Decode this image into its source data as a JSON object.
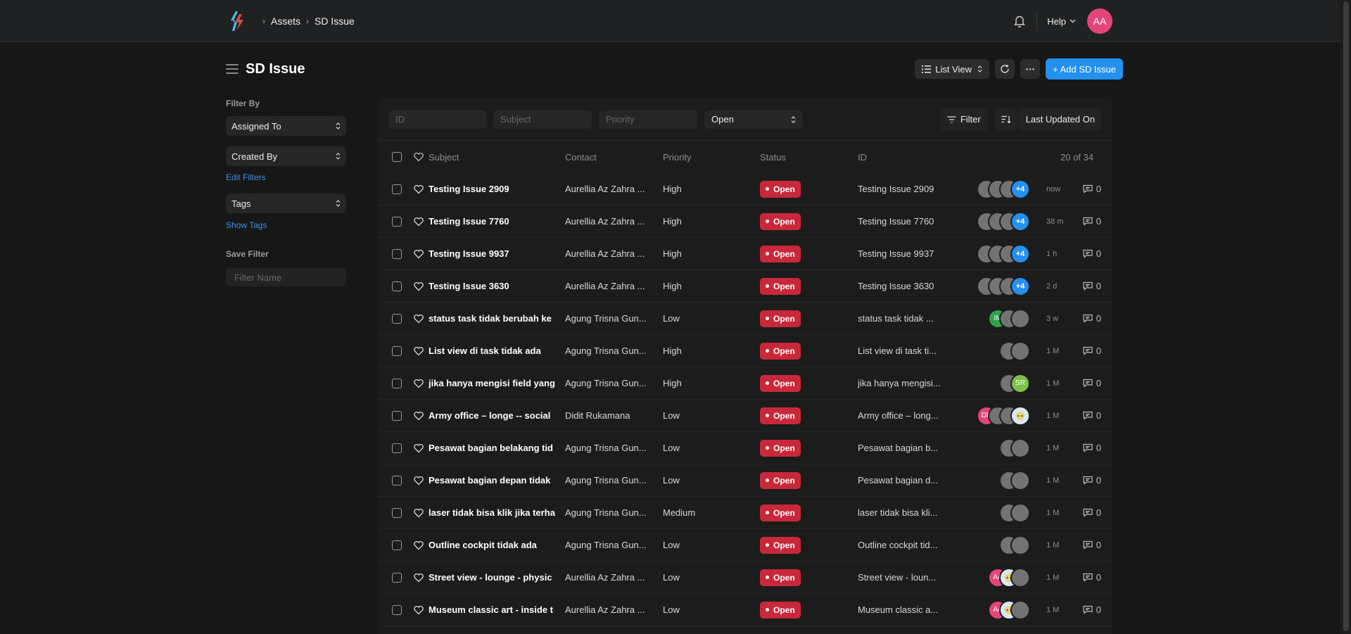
{
  "navbar": {
    "breadcrumbs": [
      "Assets",
      "SD Issue"
    ],
    "help_label": "Help",
    "user_initials": "AA"
  },
  "page": {
    "title": "SD Issue",
    "view_label": "List View",
    "add_button_label": "+ Add SD Issue"
  },
  "sidebar": {
    "filter_by_label": "Filter By",
    "assigned_to": "Assigned To",
    "created_by": "Created By",
    "edit_filters": "Edit Filters",
    "tags": "Tags",
    "show_tags": "Show Tags",
    "save_filter_label": "Save Filter",
    "filter_name_placeholder": "Filter Name"
  },
  "filters": {
    "id_placeholder": "ID",
    "subject_placeholder": "Subject",
    "priority_placeholder": "Priority",
    "status_value": "Open",
    "filter_label": "Filter",
    "sort_label": "Last Updated On"
  },
  "columns": {
    "subject": "Subject",
    "contact": "Contact",
    "priority": "Priority",
    "status": "Status",
    "id": "ID",
    "count": "20 of 34"
  },
  "rows": [
    {
      "subject": "Testing Issue 2909",
      "contact": "Aurellia Az Zahra ...",
      "priority": "High",
      "status": "Open",
      "id": "Testing Issue 2909",
      "time": "now",
      "comments": "0",
      "avatars": [
        {
          "t": ""
        },
        {
          "t": ""
        },
        {
          "t": ""
        },
        {
          "t": "+4",
          "c": "blue"
        }
      ]
    },
    {
      "subject": "Testing Issue 7760",
      "contact": "Aurellia Az Zahra ...",
      "priority": "High",
      "status": "Open",
      "id": "Testing Issue 7760",
      "time": "38 m",
      "comments": "0",
      "avatars": [
        {
          "t": ""
        },
        {
          "t": ""
        },
        {
          "t": ""
        },
        {
          "t": "+4",
          "c": "blue"
        }
      ]
    },
    {
      "subject": "Testing Issue 9937",
      "contact": "Aurellia Az Zahra ...",
      "priority": "High",
      "status": "Open",
      "id": "Testing Issue 9937",
      "time": "1 h",
      "comments": "0",
      "avatars": [
        {
          "t": ""
        },
        {
          "t": ""
        },
        {
          "t": ""
        },
        {
          "t": "+4",
          "c": "blue"
        }
      ]
    },
    {
      "subject": "Testing Issue 3630",
      "contact": "Aurellia Az Zahra ...",
      "priority": "High",
      "status": "Open",
      "id": "Testing Issue 3630",
      "time": "2 d",
      "comments": "0",
      "avatars": [
        {
          "t": ""
        },
        {
          "t": ""
        },
        {
          "t": ""
        },
        {
          "t": "+4",
          "c": "blue"
        }
      ]
    },
    {
      "subject": "status task tidak berubah ke",
      "contact": "Agung Trisna Gun...",
      "priority": "Low",
      "status": "Open",
      "id": "status task tidak ...",
      "time": "3 w",
      "comments": "0",
      "avatars": [
        {
          "t": "IM",
          "c": "green"
        },
        {
          "t": ""
        },
        {
          "t": ""
        }
      ]
    },
    {
      "subject": "List view di task tidak ada",
      "contact": "Agung Trisna Gun...",
      "priority": "High",
      "status": "Open",
      "id": "List view di task ti...",
      "time": "1 M",
      "comments": "0",
      "avatars": [
        {
          "t": ""
        },
        {
          "t": ""
        }
      ]
    },
    {
      "subject": "jika hanya mengisi field yang",
      "contact": "Agung Trisna Gun...",
      "priority": "High",
      "status": "Open",
      "id": "jika hanya mengisi...",
      "time": "1 M",
      "comments": "0",
      "avatars": [
        {
          "t": ""
        },
        {
          "t": "SR",
          "c": "lime"
        }
      ]
    },
    {
      "subject": "Army office – longe -- social",
      "contact": "Didit Rukamana",
      "priority": "Low",
      "status": "Open",
      "id": "Army office – long...",
      "time": "1 M",
      "comments": "0",
      "avatars": [
        {
          "t": "DR",
          "c": "pink"
        },
        {
          "t": ""
        },
        {
          "t": ""
        },
        {
          "t": "",
          "c": "img"
        }
      ]
    },
    {
      "subject": "Pesawat bagian belakang tid",
      "contact": "Agung Trisna Gun...",
      "priority": "Low",
      "status": "Open",
      "id": "Pesawat bagian b...",
      "time": "1 M",
      "comments": "0",
      "avatars": [
        {
          "t": ""
        },
        {
          "t": ""
        }
      ]
    },
    {
      "subject": "Pesawat bagian depan tidak",
      "contact": "Agung Trisna Gun...",
      "priority": "Low",
      "status": "Open",
      "id": "Pesawat bagian d...",
      "time": "1 M",
      "comments": "0",
      "avatars": [
        {
          "t": ""
        },
        {
          "t": ""
        }
      ]
    },
    {
      "subject": "laser tidak bisa klik jika terha",
      "contact": "Agung Trisna Gun...",
      "priority": "Medium",
      "status": "Open",
      "id": "laser tidak bisa kli...",
      "time": "1 M",
      "comments": "0",
      "avatars": [
        {
          "t": ""
        },
        {
          "t": ""
        }
      ]
    },
    {
      "subject": "Outline cockpit tidak ada",
      "contact": "Agung Trisna Gun...",
      "priority": "Low",
      "status": "Open",
      "id": "Outline cockpit tid...",
      "time": "1 M",
      "comments": "0",
      "avatars": [
        {
          "t": ""
        },
        {
          "t": ""
        }
      ]
    },
    {
      "subject": "Street view - lounge - physic",
      "contact": "Aurellia Az Zahra ...",
      "priority": "Low",
      "status": "Open",
      "id": "Street view - loun...",
      "time": "1 M",
      "comments": "0",
      "avatars": [
        {
          "t": "AA",
          "c": "pink"
        },
        {
          "t": "",
          "c": "img"
        },
        {
          "t": ""
        }
      ]
    },
    {
      "subject": "Museum classic art - inside t",
      "contact": "Aurellia Az Zahra ...",
      "priority": "Low",
      "status": "Open",
      "id": "Museum classic a...",
      "time": "1 M",
      "comments": "0",
      "avatars": [
        {
          "t": "AA",
          "c": "pink"
        },
        {
          "t": "",
          "c": "img"
        },
        {
          "t": ""
        }
      ]
    }
  ],
  "colors": {
    "accent": "#2490ef",
    "status_open": "#c8283a",
    "background": "#171717"
  }
}
